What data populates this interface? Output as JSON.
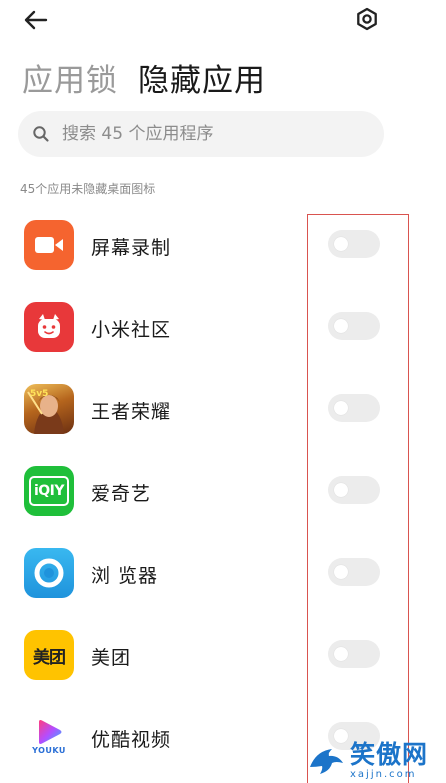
{
  "header": {
    "back_icon": "arrow-left-icon",
    "settings_icon": "gear-icon"
  },
  "tabs": [
    {
      "label": "应用锁",
      "active": false
    },
    {
      "label": "隐藏应用",
      "active": true
    }
  ],
  "search": {
    "placeholder": "搜索 45 个应用程序",
    "value": ""
  },
  "section_label": "45个应用未隐藏桌面图标",
  "apps": [
    {
      "name": "屏幕录制",
      "icon": "screen-record-icon",
      "color": "#f5642f",
      "hidden": false
    },
    {
      "name": "小米社区",
      "icon": "xiaomi-community-icon",
      "color": "#e8383a",
      "hidden": false
    },
    {
      "name": "王者荣耀",
      "icon": "honor-of-kings-icon",
      "color": "#c98a2e",
      "hidden": false
    },
    {
      "name": "爱奇艺",
      "icon": "iqiyi-icon",
      "color": "#1fbf3a",
      "hidden": false
    },
    {
      "name": "浏 览器",
      "icon": "browser-icon",
      "color": "#2aa8e8",
      "hidden": false
    },
    {
      "name": "美团",
      "icon": "meituan-icon",
      "color": "#ffc300",
      "hidden": false
    },
    {
      "name": "优酷视频",
      "icon": "youku-icon",
      "color": "#ffffff",
      "hidden": false
    }
  ],
  "icon_text": {
    "iqiyi": "iQIY",
    "meituan": "美团",
    "youku": "YOUKU",
    "honor": "5v5"
  },
  "watermark": {
    "title": "笑傲网",
    "url": "xajjn.com"
  },
  "colors": {
    "highlight": "#d9534f",
    "toggle_off": "#ececec",
    "watermark": "#1c74c9"
  }
}
